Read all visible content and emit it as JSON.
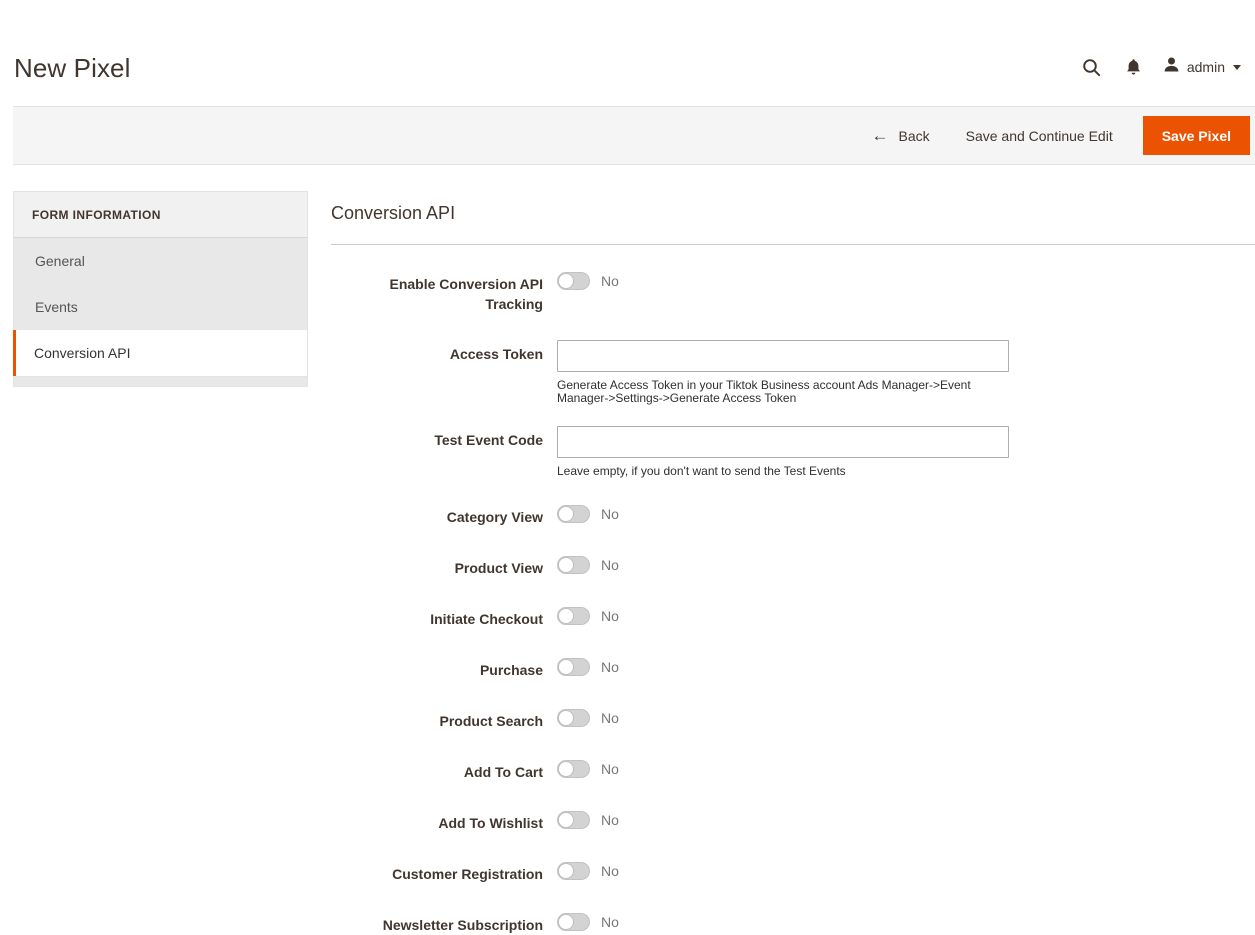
{
  "header": {
    "page_title": "New Pixel",
    "search_icon": "search-icon",
    "notifications_icon": "bell-icon",
    "avatar_icon": "user-avatar-icon",
    "admin_label": "admin",
    "caret_icon": "chevron-down-icon"
  },
  "action_bar": {
    "back_label": "Back",
    "back_arrow": "←",
    "save_continue_label": "Save and Continue Edit",
    "save_label": "Save Pixel",
    "primary_color": "#eb5202"
  },
  "sidebar": {
    "title": "Form Information",
    "accent_color": "#eb5202",
    "items": [
      {
        "label": "General",
        "active": false
      },
      {
        "label": "Events",
        "active": false
      },
      {
        "label": "Conversion API",
        "active": true
      }
    ]
  },
  "main": {
    "section_title": "Conversion API",
    "fields": [
      {
        "label": "Enable Conversion API Tracking",
        "type": "toggle",
        "state": "No",
        "on": false
      },
      {
        "label": "Access Token",
        "type": "text",
        "value": "",
        "placeholder": "",
        "note": "Generate Access Token in your Tiktok Business account Ads Manager->Event Manager->Settings->Generate Access Token"
      },
      {
        "label": "Test Event Code",
        "type": "text",
        "value": "",
        "placeholder": "",
        "note": "Leave empty, if you don't want to send the Test Events"
      },
      {
        "label": "Category View",
        "type": "toggle",
        "state": "No",
        "on": false
      },
      {
        "label": "Product View",
        "type": "toggle",
        "state": "No",
        "on": false
      },
      {
        "label": "Initiate Checkout",
        "type": "toggle",
        "state": "No",
        "on": false
      },
      {
        "label": "Purchase",
        "type": "toggle",
        "state": "No",
        "on": false
      },
      {
        "label": "Product Search",
        "type": "toggle",
        "state": "No",
        "on": false
      },
      {
        "label": "Add To Cart",
        "type": "toggle",
        "state": "No",
        "on": false
      },
      {
        "label": "Add To Wishlist",
        "type": "toggle",
        "state": "No",
        "on": false
      },
      {
        "label": "Customer Registration",
        "type": "toggle",
        "state": "No",
        "on": false
      },
      {
        "label": "Newsletter Subscription",
        "type": "toggle",
        "state": "No",
        "on": false
      }
    ]
  }
}
